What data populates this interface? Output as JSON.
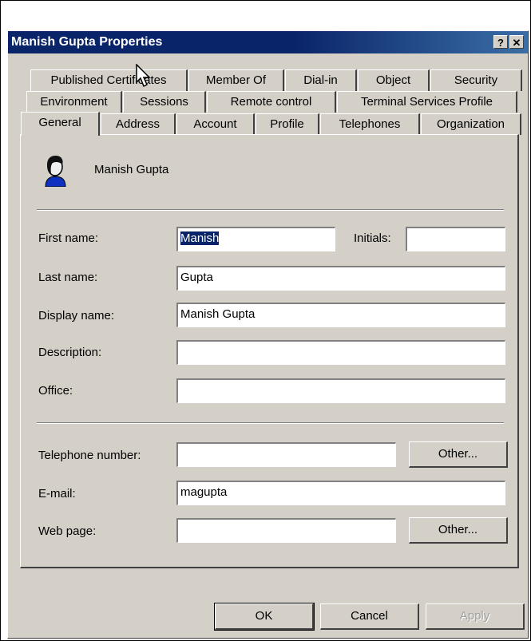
{
  "dialog": {
    "title": "Manish Gupta Properties",
    "help_button": "?",
    "close_button": "✕"
  },
  "tabs_row1": [
    "Published Certificates",
    "Member Of",
    "Dial-in",
    "Object",
    "Security"
  ],
  "tabs_row2": [
    "Environment",
    "Sessions",
    "Remote control",
    "Terminal Services Profile"
  ],
  "tabs_row3": [
    "General",
    "Address",
    "Account",
    "Profile",
    "Telephones",
    "Organization"
  ],
  "general": {
    "user_display": "Manish Gupta",
    "first_name_label": "First name:",
    "first_name_value": "Manish",
    "initials_label": "Initials:",
    "initials_value": "",
    "last_name_label": "Last name:",
    "last_name_value": "Gupta",
    "display_name_label": "Display name:",
    "display_name_value": "Manish Gupta",
    "description_label": "Description:",
    "description_value": "",
    "office_label": "Office:",
    "office_value": "",
    "telephone_label": "Telephone number:",
    "telephone_value": "",
    "email_label": "E-mail:",
    "email_value": "magupta",
    "webpage_label": "Web page:",
    "webpage_value": "",
    "other_button_1": "Other...",
    "other_button_2": "Other..."
  },
  "footer": {
    "ok": "OK",
    "cancel": "Cancel",
    "apply": "Apply"
  },
  "colors": {
    "titlebar": "#0a246a",
    "dialog_face": "#d4d0c8",
    "selection": "#0a246a"
  },
  "icons": [
    "user-icon",
    "help-icon",
    "close-icon",
    "mouse-cursor-icon"
  ]
}
